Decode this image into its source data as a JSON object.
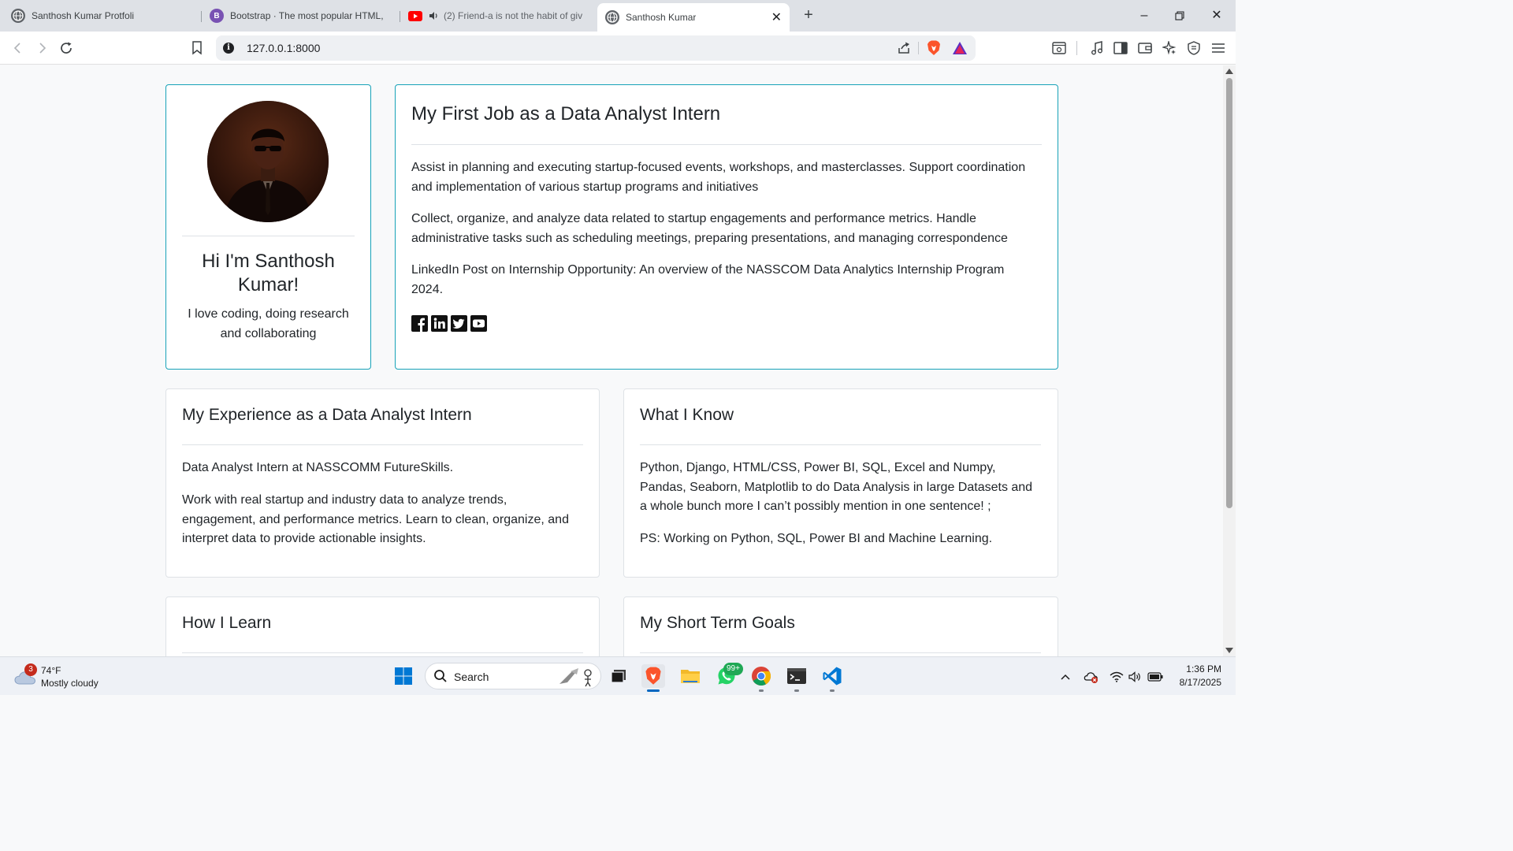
{
  "browser": {
    "tabs": [
      {
        "title": "Santhosh Kumar Protfoli",
        "favicon": "globe-icon",
        "active": false
      },
      {
        "title": "Bootstrap · The most popular HTML,",
        "favicon": "bootstrap-logo",
        "active": false
      },
      {
        "title": "(2) Friend-a is not the habit of giv",
        "favicon": "youtube-logo",
        "active": false,
        "audio": true
      },
      {
        "title": "Santhosh Kumar",
        "favicon": "globe-icon",
        "active": true
      }
    ],
    "address": "127.0.0.1:8000"
  },
  "profile": {
    "name": "Hi I'm Santhosh Kumar!",
    "bio": "I love coding, doing research and collaborating"
  },
  "job": {
    "title": "My First Job as a Data Analyst Intern",
    "paragraphs": [
      "Assist in planning and executing startup-focused events, workshops, and masterclasses. Support coordination and implementation of various startup programs and initiatives",
      "Collect, organize, and analyze data related to startup engagements and performance metrics. Handle administrative tasks such as scheduling meetings, preparing presentations, and managing correspondence",
      "LinkedIn Post on Internship Opportunity: An overview of the NASSCOM Data Analytics Internship Program 2024."
    ],
    "socials": [
      "facebook-icon",
      "linkedin-icon",
      "twitter-icon",
      "youtube-icon"
    ]
  },
  "experience": {
    "title": "My Experience as a Data Analyst Intern",
    "p1": "Data Analyst Intern at NASSCOMM FutureSkills.",
    "p2": "Work with real startup and industry data to analyze trends, engagement, and performance metrics. Learn to clean, organize, and interpret data to provide actionable insights."
  },
  "know": {
    "title": "What I Know",
    "p1": "Python, Django, HTML/CSS, Power BI, SQL, Excel and Numpy, Pandas, Seaborn, Matplotlib to do Data Analysis in large Datasets and a whole bunch more I can’t possibly mention in one sentence! ;",
    "p2": "PS: Working on Python, SQL, Power BI and Machine Learning."
  },
  "learn": {
    "title": "How I Learn"
  },
  "goals": {
    "title": "My Short Term Goals"
  },
  "taskbar": {
    "weather_badge": "3",
    "temperature": "74°F",
    "condition": "Mostly cloudy",
    "search_label": "Search",
    "whatsapp_badge": "99+",
    "time": "1:36 PM",
    "date": "8/17/2025"
  },
  "colors": {
    "card_border_accent": "#17a2b8",
    "page_bg": "#f8f9fa",
    "taskbar_bg": "#eef1f6"
  }
}
